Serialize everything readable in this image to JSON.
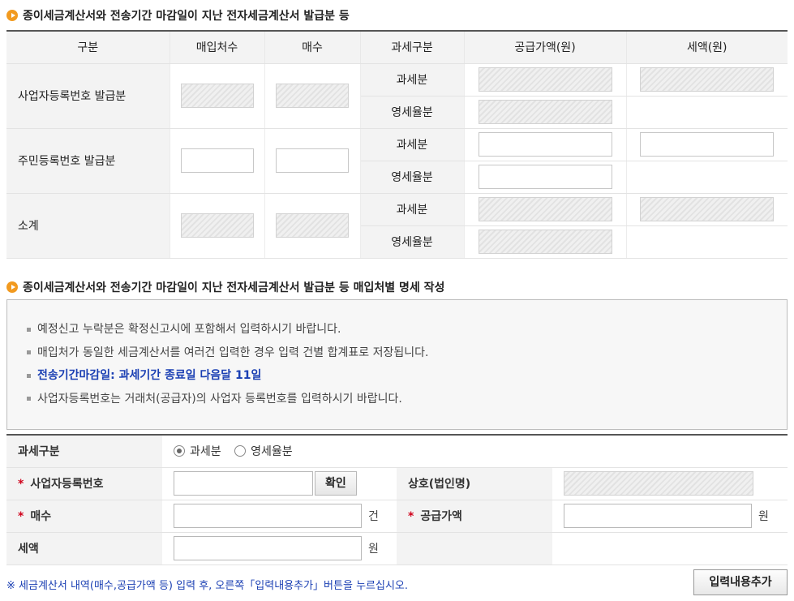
{
  "section1": {
    "title": "종이세금계산서와 전송기간 마감일이 지난 전자세금계산서 발급분 등",
    "headers": [
      "구분",
      "매입처수",
      "매수",
      "과세구분",
      "공급가액(원)",
      "세액(원)"
    ],
    "rows": [
      {
        "label": "사업자등록번호 발급분",
        "sub1": "과세분",
        "sub2": "영세율분"
      },
      {
        "label": "주민등록번호 발급분",
        "sub1": "과세분",
        "sub2": "영세율분"
      },
      {
        "label": "소계",
        "sub1": "과세분",
        "sub2": "영세율분"
      }
    ]
  },
  "section2": {
    "title": "종이세금계산서와 전송기간 마감일이 지난 전자세금계산서 발급분 등 매입처별 명세 작성",
    "notices": [
      "예정신고 누락분은 확정신고시에 포함해서 입력하시기 바랍니다.",
      "매입처가 동일한 세금계산서를 여러건 입력한 경우 입력 건별 합계표로 저장됩니다.",
      "전송기간마감일: 과세기간 종료일 다음달 11일",
      "사업자등록번호는 거래처(공급자)의 사업자 등록번호를 입력하시기 바랍니다."
    ]
  },
  "form": {
    "tax_type_label": "과세구분",
    "radio_taxable": "과세분",
    "radio_zero": "영세율분",
    "bizno_label": "사업자등록번호",
    "confirm_button": "확인",
    "company_label": "상호(법인명)",
    "count_label": "매수",
    "count_unit": "건",
    "supply_label": "공급가액",
    "supply_unit": "원",
    "tax_label": "세액",
    "tax_unit": "원",
    "required_mark": "*"
  },
  "footnote": "※ 세금계산서 내역(매수,공급가액 등) 입력 후, 오른쪽「입력내용추가」버튼을 누르십시오.",
  "add_button": "입력내용추가"
}
